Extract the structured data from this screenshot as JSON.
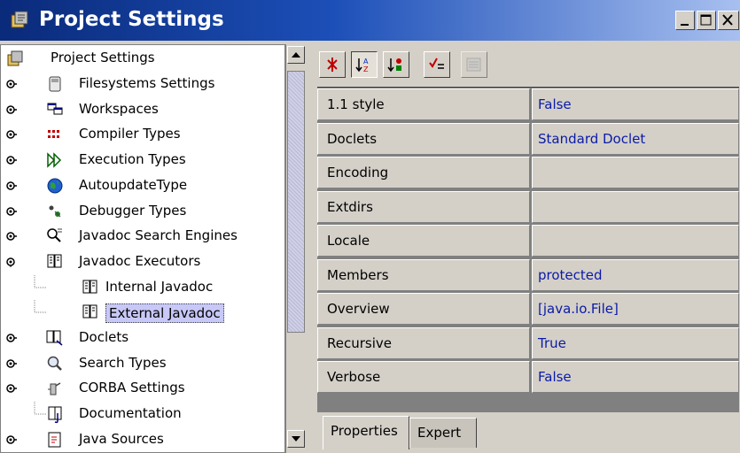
{
  "window": {
    "title": "Project Settings",
    "controls": [
      "minimize",
      "maximize",
      "close"
    ]
  },
  "tree": {
    "root_label": "Project Settings",
    "items": [
      {
        "label": "Filesystems Settings",
        "icon": "filesystem-icon",
        "expandable": true
      },
      {
        "label": "Workspaces",
        "icon": "workspaces-icon",
        "expandable": true
      },
      {
        "label": "Compiler Types",
        "icon": "compiler-icon",
        "expandable": true
      },
      {
        "label": "Execution Types",
        "icon": "execution-icon",
        "expandable": true
      },
      {
        "label": "AutoupdateType",
        "icon": "globe-icon",
        "expandable": true
      },
      {
        "label": "Debugger Types",
        "icon": "debugger-icon",
        "expandable": true
      },
      {
        "label": "Javadoc Search Engines",
        "icon": "search-engine-icon",
        "expandable": true
      },
      {
        "label": "Javadoc Executors",
        "icon": "javadoc-icon",
        "expandable": true,
        "expanded": true
      },
      {
        "label": "Internal Javadoc",
        "icon": "javadoc-icon",
        "child": true
      },
      {
        "label": "External Javadoc",
        "icon": "javadoc-icon",
        "child": true,
        "selected": true
      },
      {
        "label": "Doclets",
        "icon": "doclets-icon",
        "expandable": true
      },
      {
        "label": "Search Types",
        "icon": "magnifier-icon",
        "expandable": true
      },
      {
        "label": "CORBA Settings",
        "icon": "corba-icon",
        "expandable": true
      },
      {
        "label": "Documentation",
        "icon": "documentation-icon",
        "expandable": false
      },
      {
        "label": "Java Sources",
        "icon": "java-sources-icon",
        "expandable": true
      }
    ]
  },
  "toolbar": {
    "buttons": [
      "unsorted-icon",
      "sort-by-name-icon",
      "sort-by-type-icon",
      "show-editable-icon",
      "customize-icon"
    ]
  },
  "properties": [
    {
      "name": "1.1 style",
      "value": "False"
    },
    {
      "name": "Doclets",
      "value": "Standard Doclet"
    },
    {
      "name": "Encoding",
      "value": ""
    },
    {
      "name": "Extdirs",
      "value": ""
    },
    {
      "name": "Locale",
      "value": ""
    },
    {
      "name": "Members",
      "value": "protected"
    },
    {
      "name": "Overview",
      "value": "[java.io.File]"
    },
    {
      "name": "Recursive",
      "value": "True"
    },
    {
      "name": "Verbose",
      "value": "False"
    }
  ],
  "tabs": [
    {
      "label": "Properties",
      "active": true
    },
    {
      "label": "Expert",
      "active": false
    }
  ],
  "colors": {
    "title_gradient_start": "#0a2a7a",
    "title_gradient_end": "#a8c0f0",
    "property_value_text": "#0a1aa8",
    "selection": "#c8c8f8"
  }
}
